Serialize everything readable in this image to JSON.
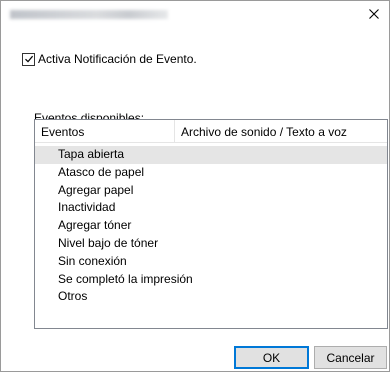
{
  "window": {
    "close_icon": "close-icon"
  },
  "notification": {
    "label": "Activa Notificación de Evento.",
    "checked": true
  },
  "events": {
    "group_label": "Eventos disponibles:",
    "columns": [
      "Eventos",
      "Archivo de sonido / Texto a voz"
    ],
    "items": [
      "Tapa abierta",
      "Atasco de papel",
      "Agregar papel",
      "Inactividad",
      "Agregar tóner",
      "Nivel bajo de tóner",
      "Sin conexión",
      "Se completó la impresión",
      "Otros"
    ],
    "selected_index": 0
  },
  "buttons": {
    "ok": "OK",
    "cancel": "Cancelar"
  },
  "colors": {
    "accent": "#0078d7",
    "selection": "#e5e5e5"
  }
}
